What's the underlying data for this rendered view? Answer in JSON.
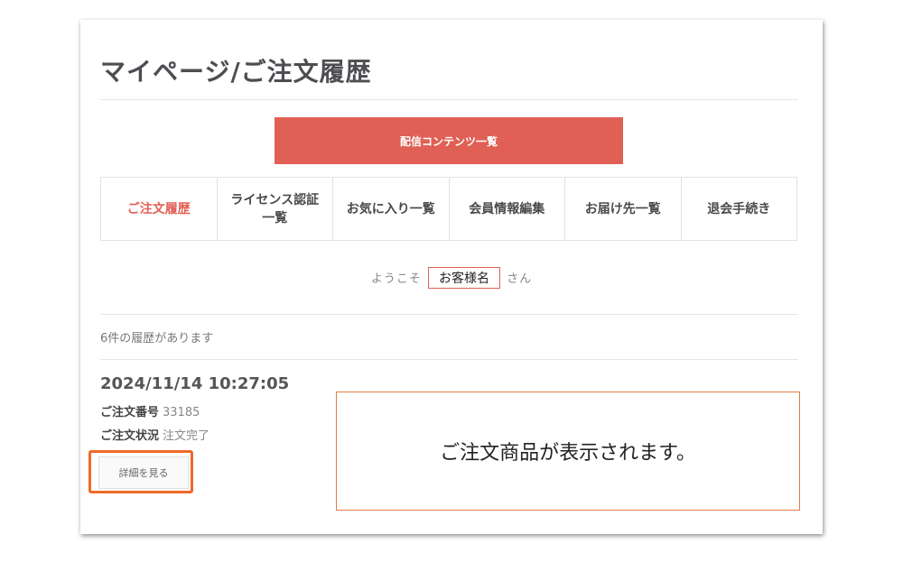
{
  "page": {
    "title": "マイページ/ご注文履歴"
  },
  "content_button": {
    "label": "配信コンテンツ一覧"
  },
  "nav": {
    "items": [
      {
        "label": "ご注文履歴",
        "active": true
      },
      {
        "label": "ライセンス認証\n一覧",
        "active": false
      },
      {
        "label": "お気に入り一覧",
        "active": false
      },
      {
        "label": "会員情報編集",
        "active": false
      },
      {
        "label": "お届け先一覧",
        "active": false
      },
      {
        "label": "退会手続き",
        "active": false
      }
    ]
  },
  "welcome": {
    "prefix": "ようこそ",
    "name": "お客様名",
    "suffix": "さん"
  },
  "history": {
    "count_text": "6件の履歴があります"
  },
  "order": {
    "datetime": "2024/11/14 10:27:05",
    "number_label": "ご注文番号",
    "number_value": "33185",
    "status_label": "ご注文状況",
    "status_value": "注文完了",
    "detail_button": "詳細を見る",
    "products_placeholder": "ご注文商品が表示されます。"
  },
  "colors": {
    "accent": "#e06055",
    "highlight": "#ee6a2a"
  }
}
